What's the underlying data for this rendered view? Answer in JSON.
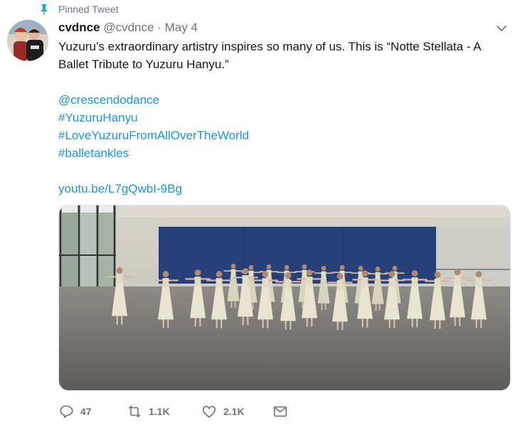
{
  "pinned": {
    "label": "Pinned Tweet",
    "icon": "pin-icon"
  },
  "user": {
    "name": "cvdnce",
    "handle": "@cvdnce",
    "separator": "·",
    "date": "May 4"
  },
  "tweet": {
    "line1": "Yuzuru’s extraordinary artistry inspires so many of us.   This is “Notte Stellata - A",
    "line2": "Ballet Tribute to Yuzuru Hanyu.”",
    "mention": "@crescendodance",
    "hashtags": [
      "#YuzuruHanyu",
      "#LoveYuzuruFromAllOverTheWorld",
      "#balletankles"
    ],
    "url": "youtu.be/L7gQwbI-9Bg"
  },
  "actions": {
    "reply": {
      "count": "47",
      "icon": "reply-icon"
    },
    "retweet": {
      "count": "1.1K",
      "icon": "retweet-icon"
    },
    "like": {
      "count": "2.1K",
      "icon": "heart-icon"
    },
    "message": {
      "icon": "envelope-icon"
    }
  },
  "colors": {
    "link": "#1b95e0",
    "muted": "#657786",
    "text": "#14171a",
    "pin": "#1da1f2"
  }
}
